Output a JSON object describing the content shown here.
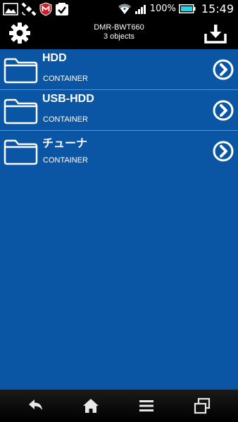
{
  "status_bar": {
    "battery_percent": "100%",
    "time": "15:49"
  },
  "header": {
    "device_name": "DMR-BWT660",
    "object_count": "3 objects"
  },
  "items": [
    {
      "title": "HDD",
      "subtitle": "CONTAINER"
    },
    {
      "title": "USB-HDD",
      "subtitle": "CONTAINER"
    },
    {
      "title": "チューナ",
      "subtitle": "CONTAINER"
    }
  ],
  "colors": {
    "background": "#0a55a4",
    "header": "#000000",
    "divider": "#5a8fca"
  },
  "icons": {
    "header_left": "gear-icon",
    "header_right": "download-icon",
    "item": "folder-icon",
    "item_action": "chevron-right-circle-icon",
    "nav": [
      "back-icon",
      "home-icon",
      "menu-icon",
      "recent-apps-icon"
    ]
  }
}
